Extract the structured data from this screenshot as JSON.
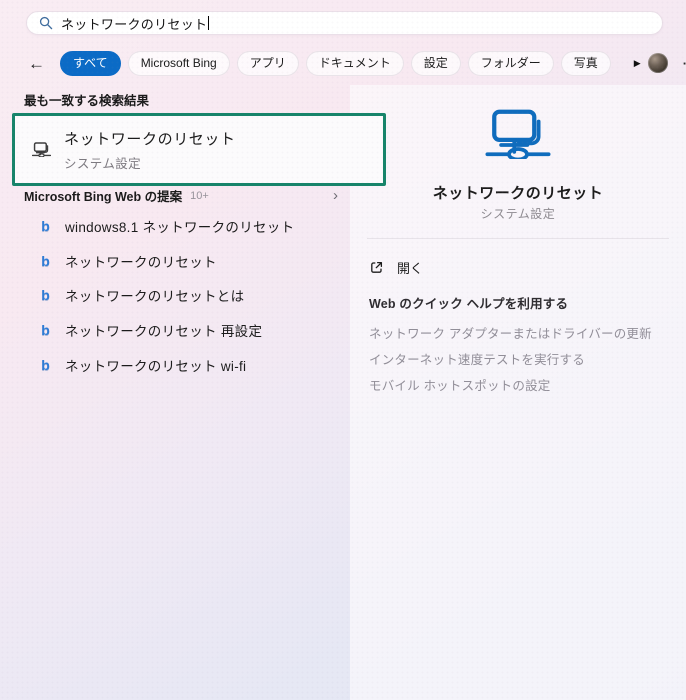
{
  "colors": {
    "accent_blue": "#0b6bc6",
    "annotation_green": "#17846a",
    "icon_blue": "#0f6cbd"
  },
  "search_bar": {
    "value": "ネットワークのリセット"
  },
  "filter_bar": {
    "back_icon": "←",
    "tabs": [
      {
        "label": "すべて",
        "selected": true
      },
      {
        "label": "Microsoft Bing",
        "selected": false
      },
      {
        "label": "アプリ",
        "selected": false
      },
      {
        "label": "ドキュメント",
        "selected": false
      },
      {
        "label": "設定",
        "selected": false
      },
      {
        "label": "フォルダー",
        "selected": false
      },
      {
        "label": "写真",
        "selected": false
      }
    ],
    "more_icon": "▶",
    "overflow_icon": "···"
  },
  "results": {
    "best_match_header": "最も一致する検索結果",
    "best_match": {
      "title": "ネットワークのリセット",
      "subtitle": "システム設定"
    },
    "bing_section": {
      "title": "Microsoft Bing Web の提案",
      "count": "10+",
      "chevron": "›"
    },
    "suggestions": [
      "windows8.1 ネットワークのリセット",
      "ネットワークのリセット",
      "ネットワークのリセットとは",
      "ネットワークのリセット 再設定",
      "ネットワークのリセット wi-fi"
    ]
  },
  "preview": {
    "title": "ネットワークのリセット",
    "subtitle": "システム設定",
    "open_label": "開く",
    "quick_links": [
      {
        "label": "Web のクイック ヘルプを利用する"
      },
      {
        "label": "ネットワーク アダプターまたはドライバーの更新"
      },
      {
        "label": "インターネット速度テストを実行する"
      },
      {
        "label": "モバイル ホットスポットの設定"
      }
    ]
  }
}
